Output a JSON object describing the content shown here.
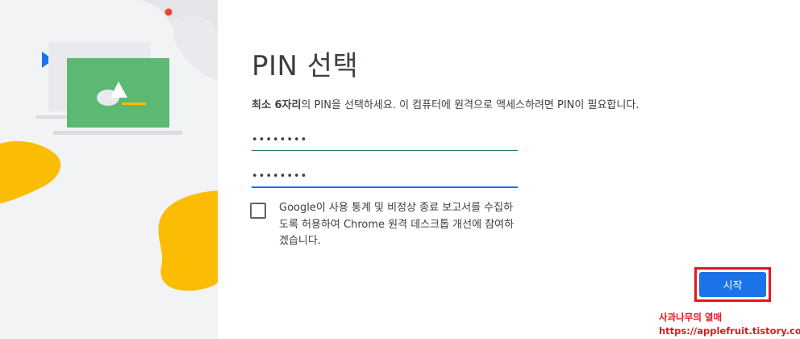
{
  "dialog": {
    "title": "PIN 선택",
    "description_bold": "최소 6자리",
    "description_rest": "의 PIN을 선택하세요. 이 컴퓨터에 원격으로 액세스하려면 PIN이 필요합니다.",
    "pin_value": "••••••••",
    "pin_confirm_value": "••••••••",
    "consent_checked": false,
    "consent_text": "Google이 사용 통계 및 비정상 종료 보고서를 수집하도록 허용하여 Chrome 원격 데스크톱 개선에 참여하겠습니다.",
    "start_label": "시작"
  },
  "watermark": {
    "line1": "사과나무의 열매",
    "line2": "https://applefruit.tistory.com/"
  },
  "colors": {
    "accent": "#1a73e8",
    "highlight": "#e8141d",
    "illustration_green": "#5bb974",
    "illustration_yellow": "#fbbc04",
    "illustration_blue": "#1a73e8",
    "illustration_red": "#ea4335"
  },
  "illustration": {
    "icons": [
      "laptop-icon",
      "mountain-icon",
      "play-triangle-icon"
    ]
  }
}
